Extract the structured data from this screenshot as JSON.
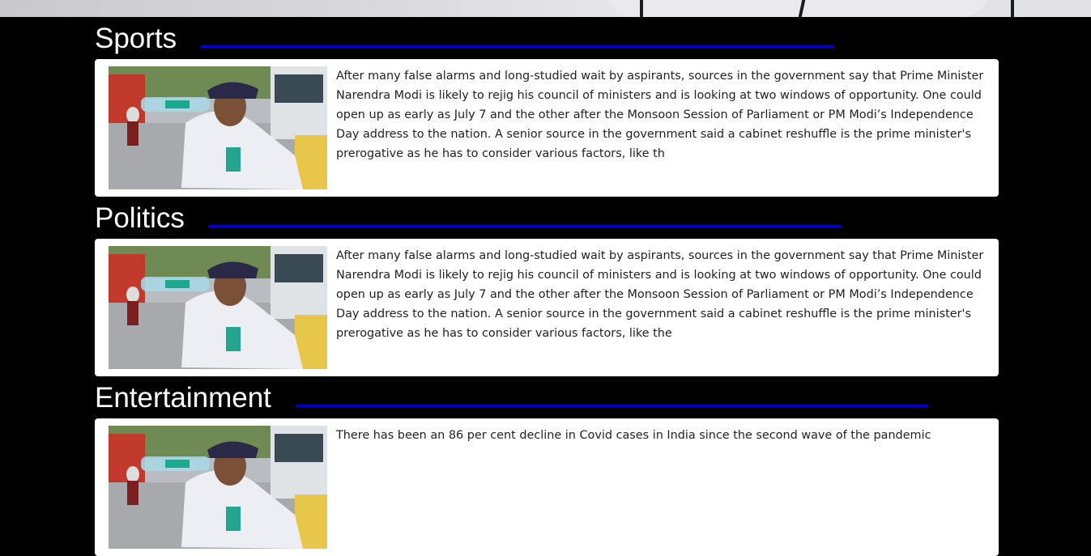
{
  "sections": [
    {
      "title": "Sports",
      "line_color": "#0000c8",
      "article": {
        "image_alt": "Traffic policeman drinking water from a bottle on a city street",
        "excerpt": "After many false alarms and long-studied wait by aspirants, sources in the government say that Prime Minister Narendra Modi is likely to rejig his council of ministers and is looking at two windows of opportunity. One could open up as early as July 7 and the other after the Monsoon Session of Parliament or PM Modi’s Independence Day address to the nation. A senior source in the government said a cabinet reshuffle is the prime minister's prerogative as he has to consider various factors, like th"
      }
    },
    {
      "title": "Politics",
      "line_color": "#0000c8",
      "article": {
        "image_alt": "Traffic policeman drinking water from a bottle on a city street",
        "excerpt": "After many false alarms and long-studied wait by aspirants, sources in the government say that Prime Minister Narendra Modi is likely to rejig his council of ministers and is looking at two windows of opportunity. One could open up as early as July 7 and the other after the Monsoon Session of Parliament or PM Modi’s Independence Day address to the nation. A senior source in the government said a cabinet reshuffle is the prime minister's prerogative as he has to consider various factors, like the"
      }
    },
    {
      "title": "Entertainment",
      "line_color": "#0000c8",
      "article": {
        "image_alt": "Traffic policeman drinking water from a bottle on a city street",
        "excerpt": "There has been an 86 per cent decline in Covid cases in India since the second wave of the pandemic"
      }
    }
  ]
}
